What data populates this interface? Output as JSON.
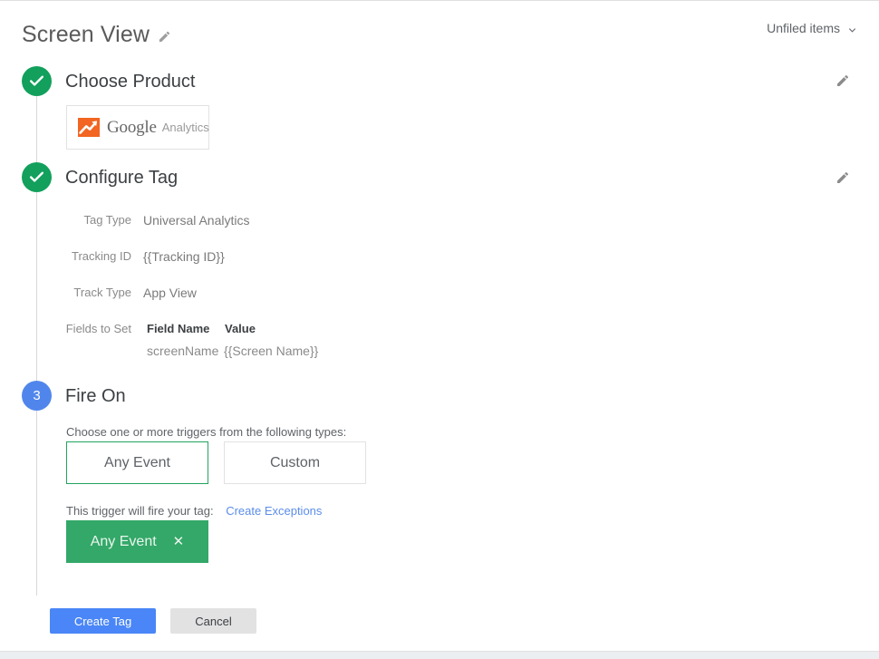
{
  "header": {
    "title": "Screen View",
    "title_edit_icon": "pencil-icon",
    "workspace": "Unfiled items",
    "workspace_chevron": "chevron-down-icon"
  },
  "steps": [
    {
      "index": "1",
      "state": "done",
      "state_icon": "check-icon",
      "title": "Choose Product",
      "edit_icon": "pencil-icon"
    },
    {
      "index": "2",
      "state": "done",
      "state_icon": "check-icon",
      "title": "Configure Tag",
      "edit_icon": "pencil-icon"
    },
    {
      "index": "3",
      "state": "active",
      "state_icon": "number-3",
      "title": "Fire On"
    }
  ],
  "product": {
    "icon": "google-analytics-icon",
    "brand": "Google",
    "name": "Analytics"
  },
  "configure": {
    "rows": [
      {
        "label": "Tag Type",
        "value": "Universal Analytics"
      },
      {
        "label": "Tracking ID",
        "value": "{{Tracking ID}}"
      },
      {
        "label": "Track Type",
        "value": "App View"
      }
    ],
    "fields_to_set": {
      "label": "Fields to Set",
      "columns": [
        "Field Name",
        "Value"
      ],
      "rows": [
        {
          "field_name": "screenName",
          "value": "{{Screen Name}}"
        }
      ]
    }
  },
  "fire_on": {
    "hint": "Choose one or more triggers from the following types:",
    "trigger_types": [
      {
        "label": "Any Event",
        "selected": true
      },
      {
        "label": "Custom",
        "selected": false
      }
    ],
    "trigger_summary": "This trigger will fire your tag:",
    "exceptions_link": "Create Exceptions",
    "selected_triggers": [
      {
        "label": "Any Event",
        "remove_icon": "close-icon"
      }
    ]
  },
  "footer": {
    "primary": "Create Tag",
    "secondary": "Cancel"
  },
  "colors": {
    "green": "#12a05c",
    "chip_green": "#33a868",
    "blue": "#5086ec",
    "primary_button": "#4a86f7",
    "link": "#5b8dea",
    "ga_orange": "#f26522"
  }
}
